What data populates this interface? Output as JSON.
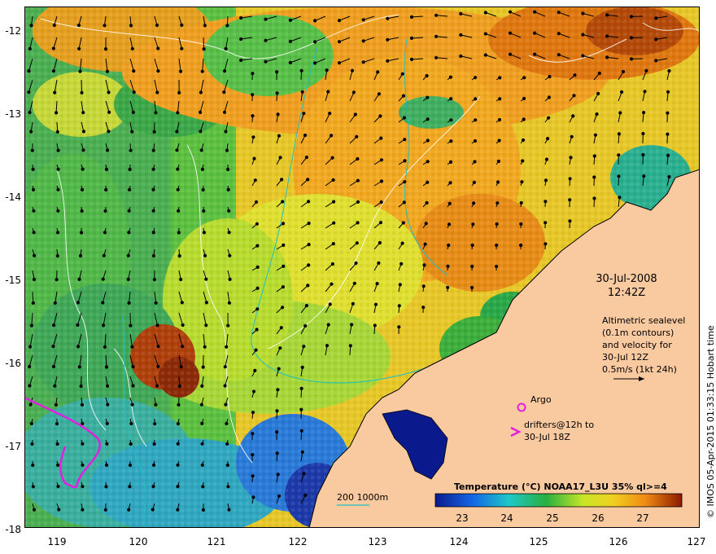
{
  "map": {
    "lat_ticks": [
      "-12",
      "-13",
      "-14",
      "-15",
      "-16",
      "-17",
      "-18"
    ],
    "lon_ticks": [
      "119",
      "120",
      "121",
      "122",
      "123",
      "124",
      "125",
      "126",
      "127"
    ],
    "date": "30-Jul-2008",
    "time": "12:42Z",
    "legend_lines": [
      "Altimetric sealevel",
      "(0.1m contours)",
      "and velocity for",
      "30-Jul 12Z",
      "0.5m/s (1kt 24h)"
    ],
    "argo_label": "Argo",
    "drifters_lines": [
      "drifters@12h to",
      "30-Jul 18Z"
    ],
    "bathy_label": "200  1000m",
    "colorbar_title": "Temperature (°C) NOAA17_L3U 35% ql>=4",
    "colorbar_ticks": [
      "23",
      "24",
      "25",
      "26",
      "27"
    ],
    "credit": "© IMOS 05-Apr-2015 01:33:15 Hobart time",
    "colors": {
      "land": "#f9c9a0",
      "cold": "#0a1a8c",
      "warm": "#8c1a00",
      "argo_marker": "#e020e0",
      "bathy_contour": "#20c0c0"
    }
  }
}
